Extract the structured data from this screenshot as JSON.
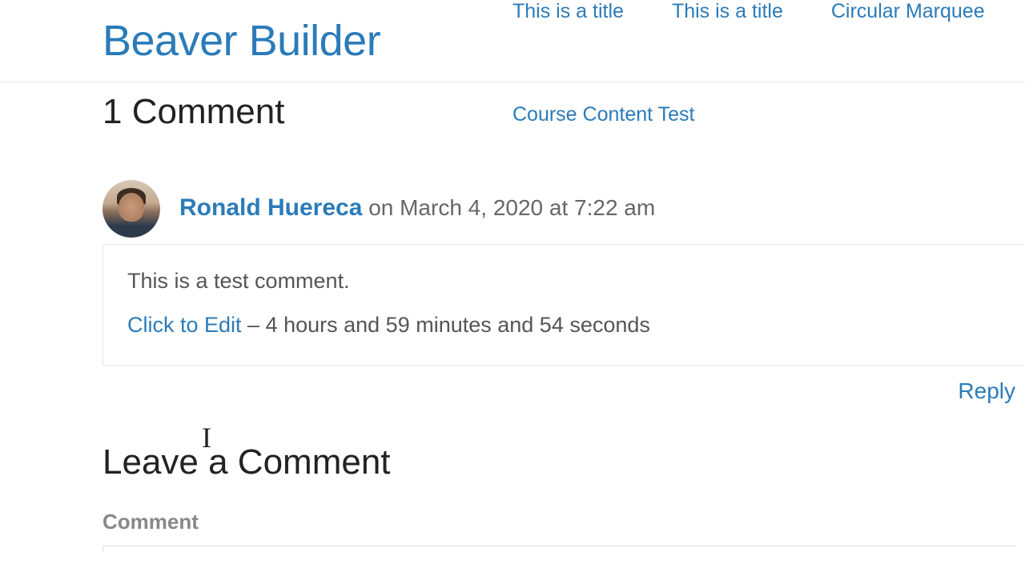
{
  "header": {
    "site_title": "Beaver Builder",
    "nav": [
      "This is a title",
      "This is a title",
      "Circular Marquee",
      "Course Content Test"
    ]
  },
  "comments": {
    "heading": "1 Comment",
    "entry": {
      "author": "Ronald Huereca",
      "meta": "on March 4, 2020 at 7:22 am",
      "body": "This is a test comment.",
      "edit_label": "Click to Edit",
      "edit_sep": " – ",
      "edit_timer": "4 hours and 59 minutes and 54 seconds",
      "reply": "Reply"
    }
  },
  "form": {
    "heading": "Leave a Comment",
    "label_comment": "Comment"
  }
}
